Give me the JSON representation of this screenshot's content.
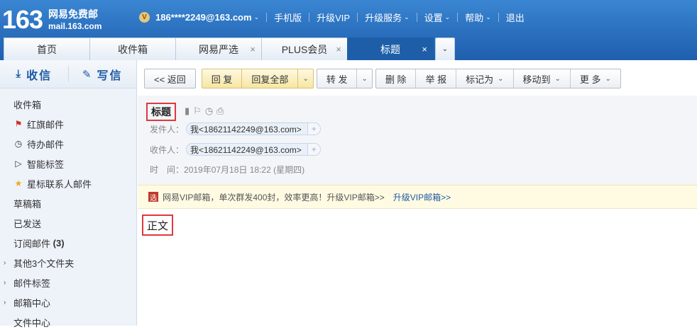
{
  "brand": {
    "number": "163",
    "name": "网易免费邮",
    "domain": "mail.163.com"
  },
  "topnav": {
    "vip_badge": "V",
    "account": "186****2249@163.com",
    "items": [
      "手机版",
      "升级VIP",
      "升级服务",
      "设置",
      "帮助",
      "退出"
    ]
  },
  "tabs": [
    {
      "label": "首页",
      "closable": false,
      "active": false
    },
    {
      "label": "收件箱",
      "closable": false,
      "active": false
    },
    {
      "label": "网易严选",
      "closable": true,
      "active": false
    },
    {
      "label": "PLUS会员",
      "closable": true,
      "active": false
    },
    {
      "label": "标题",
      "closable": true,
      "active": true
    }
  ],
  "tab_close": "×",
  "sidebar": {
    "receive": "收信",
    "compose": "写信",
    "folders": [
      {
        "label": "收件箱"
      },
      {
        "label": "红旗邮件"
      },
      {
        "label": "待办邮件"
      },
      {
        "label": "智能标签"
      },
      {
        "label": "星标联系人邮件"
      },
      {
        "label": "草稿箱"
      },
      {
        "label": "已发送"
      },
      {
        "label": "订阅邮件",
        "count": "(3)"
      },
      {
        "label": "其他3个文件夹"
      },
      {
        "label": "邮件标签"
      },
      {
        "label": "邮箱中心"
      },
      {
        "label": "文件中心"
      }
    ]
  },
  "toolbar": {
    "back": "<< 返回",
    "reply": "回 复",
    "reply_all": "回复全部",
    "forward": "转 发",
    "delete": "删 除",
    "report": "举 报",
    "mark_as": "标记为",
    "move_to": "移动到",
    "more": "更 多"
  },
  "mail": {
    "subject": "标题",
    "from_label": "发件人：",
    "from_value": "我<18621142249@163.com>",
    "to_label": "收件人：",
    "to_value": "我<18621142249@163.com>",
    "time_label": "时　间：",
    "time_value": "2019年07月18日 18:22 (星期四)",
    "body": "正文"
  },
  "ad": {
    "badge": "选",
    "text": "网易VIP邮箱，单次群发400封，效率更高！升级VIP邮箱>>",
    "link": "升级VIP邮箱>>"
  }
}
